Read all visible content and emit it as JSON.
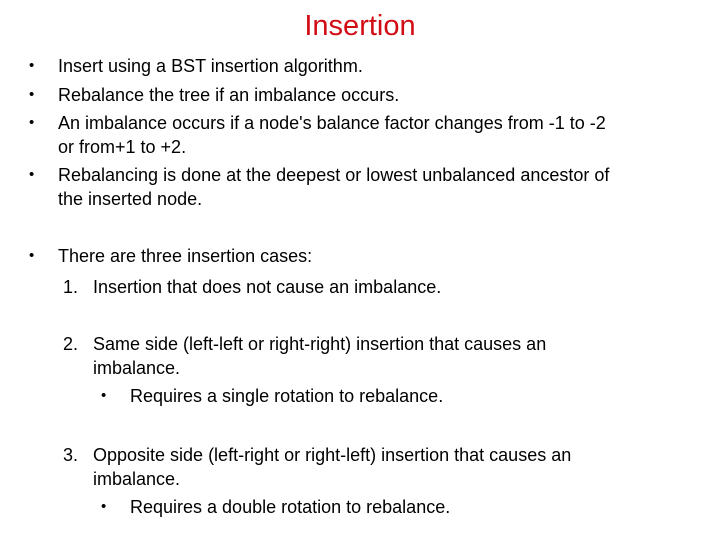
{
  "slide": {
    "title": "Insertion",
    "accent_color": "#d10c14",
    "bullets": [
      {
        "marker": "•",
        "lines": [
          "Insert using a BST insertion algorithm."
        ]
      },
      {
        "marker": "•",
        "lines": [
          "Rebalance the tree if an imbalance occurs."
        ]
      },
      {
        "marker": "•",
        "lines": [
          "An imbalance occurs if a node's balance factor changes from -1 to -2",
          "or from+1 to +2."
        ]
      },
      {
        "marker": "•",
        "lines": [
          "Rebalancing is done at the deepest or lowest unbalanced ancestor of",
          "the inserted node."
        ]
      },
      {
        "marker": "•",
        "lines": [
          "There are three insertion cases:"
        ]
      }
    ],
    "cases": [
      {
        "number": "1.",
        "lines": [
          "Insertion that does not cause an imbalance."
        ]
      },
      {
        "number": "2.",
        "lines": [
          "Same side (left-left or right-right) insertion that causes an",
          "imbalance."
        ],
        "sub": {
          "marker": "•",
          "text": "Requires a single rotation to rebalance."
        }
      },
      {
        "number": "3.",
        "lines": [
          "Opposite side (left-right or right-left) insertion that causes an",
          "imbalance."
        ],
        "sub": {
          "marker": "•",
          "text": "Requires a double rotation to rebalance."
        }
      }
    ]
  }
}
